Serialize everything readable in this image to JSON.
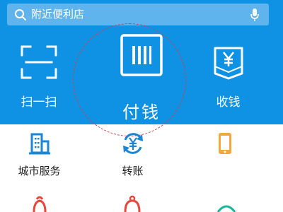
{
  "search": {
    "placeholder": "附近便利店"
  },
  "quick_actions": [
    {
      "label": "扫一扫",
      "icon": "scan-icon"
    },
    {
      "label": "付钱",
      "icon": "barcode-icon"
    },
    {
      "label": "收钱",
      "icon": "yen-envelope-icon"
    }
  ],
  "grid": [
    {
      "label": "城市服务",
      "icon": "city-building-icon"
    },
    {
      "label": "转账",
      "icon": "yen-transfer-icon"
    },
    {
      "label": "",
      "icon": "phone-icon"
    }
  ],
  "colors": {
    "header_bg": "#0f92e3",
    "search_bg": "#5fb4ee",
    "highlight_circle": "#d33f4b",
    "grid_icon_blue": "#1a86d6",
    "grid_icon_orange": "#f2a93b"
  }
}
